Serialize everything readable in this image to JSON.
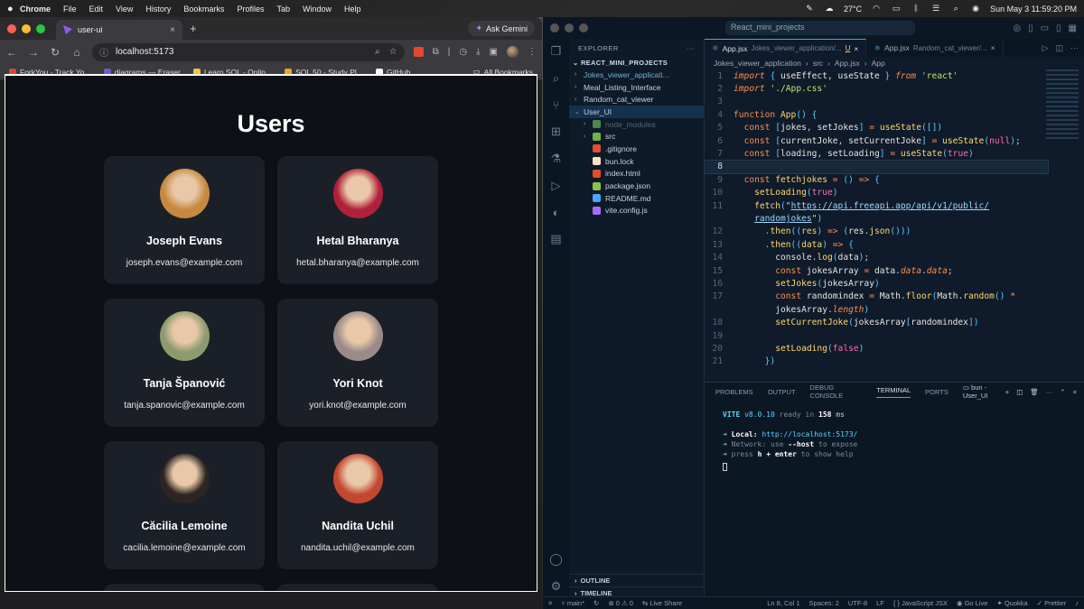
{
  "menubar": {
    "apple": "",
    "items": [
      "Chrome",
      "File",
      "Edit",
      "View",
      "History",
      "Bookmarks",
      "Profiles",
      "Tab",
      "Window",
      "Help"
    ],
    "weather": "27°C",
    "datetime": "Sun May 3  11:59:20 PM"
  },
  "chrome": {
    "tab_title": "user-ui",
    "tab_close": "×",
    "new_tab": "+",
    "ask_gemini": "Ask Gemini",
    "url": "localhost:5173",
    "bookmarks": [
      {
        "label": "ForkYou - Track Yo...",
        "color": "#d9453a"
      },
      {
        "label": "diagrams — Eraser",
        "color": "#6d5bd0"
      },
      {
        "label": "Learn SQL - Onlin...",
        "color": "#f5c242"
      },
      {
        "label": "SQL 50 - Study Pl...",
        "color": "#f0a32b"
      },
      {
        "label": "GitHub",
        "color": "#ffffff"
      }
    ],
    "all_bookmarks": "All Bookmarks"
  },
  "page": {
    "title": "Users",
    "users": [
      {
        "name": "Joseph Evans",
        "email": "joseph.evans@example.com",
        "avatar_color": "#c7893f"
      },
      {
        "name": "Hetal Bharanya",
        "email": "hetal.bharanya@example.com",
        "avatar_color": "#b0203a"
      },
      {
        "name": "Tanja Španović",
        "email": "tanja.spanovic@example.com",
        "avatar_color": "#8c9a6e"
      },
      {
        "name": "Yori Knot",
        "email": "yori.knot@example.com",
        "avatar_color": "#9a8a88"
      },
      {
        "name": "Căcilia Lemoine",
        "email": "cacilia.lemoine@example.com",
        "avatar_color": "#2d2522"
      },
      {
        "name": "Nandita Uchil",
        "email": "nandita.uchil@example.com",
        "avatar_color": "#c4472f"
      }
    ]
  },
  "vscode": {
    "search": "React_mini_projects",
    "explorer_label": "EXPLORER",
    "root": "REACT_MINI_PROJECTS",
    "tree": [
      {
        "label": "Jokes_viewer_applicati...",
        "type": "folder",
        "chev": "›",
        "indent": 0,
        "color": "#6fb3d2"
      },
      {
        "label": "Meal_Listing_Interface",
        "type": "folder",
        "chev": "›",
        "indent": 0,
        "color": "#c7d2dc"
      },
      {
        "label": "Random_cat_viewer",
        "type": "folder",
        "chev": "›",
        "indent": 0,
        "color": "#c7d2dc"
      },
      {
        "label": "User_UI",
        "type": "folder",
        "chev": "⌄",
        "indent": 0,
        "color": "#c7d2dc"
      },
      {
        "label": "node_modules",
        "type": "folder",
        "chev": "›",
        "indent": 1,
        "color": "#566677"
      },
      {
        "label": "src",
        "type": "folder",
        "chev": "›",
        "indent": 1,
        "color": "#c7d2dc"
      },
      {
        "label": ".gitignore",
        "type": "file",
        "chev": "",
        "indent": 1,
        "color": "#c7d2dc"
      },
      {
        "label": "bun.lock",
        "type": "file",
        "chev": "",
        "indent": 1,
        "color": "#c7d2dc"
      },
      {
        "label": "index.html",
        "type": "file",
        "chev": "",
        "indent": 1,
        "color": "#c7d2dc"
      },
      {
        "label": "package.json",
        "type": "file",
        "chev": "",
        "indent": 1,
        "color": "#c7d2dc"
      },
      {
        "label": "README.md",
        "type": "file",
        "chev": "",
        "indent": 1,
        "color": "#c7d2dc"
      },
      {
        "label": "vite.config.js",
        "type": "file",
        "chev": "",
        "indent": 1,
        "color": "#c7d2dc"
      }
    ],
    "outline": "OUTLINE",
    "timeline": "TIMELINE",
    "tabs": [
      {
        "file": "App.jsx",
        "path": "Jokes_viewer_application/...",
        "flag": "U",
        "active": true
      },
      {
        "file": "App.jsx",
        "path": "Random_cat_viewer/...",
        "flag": "",
        "active": false
      }
    ],
    "breadcrumbs": [
      "Jokes_viewer_application",
      "src",
      "App.jsx",
      "App"
    ],
    "code_lines": [
      {
        "no": "1",
        "html": "<span class=\"kw\">import</span> <span class=\"p\">{</span> <span class=\"v\">useEffect</span>, <span class=\"v\">useState</span> <span class=\"p\">}</span> <span class=\"kw\">from</span> <span class=\"s\">'react'</span>"
      },
      {
        "no": "2",
        "html": "<span class=\"kw\">import</span> <span class=\"s\">'./App.css'</span>"
      },
      {
        "no": "3",
        "html": ""
      },
      {
        "no": "4",
        "html": "<span class=\"k\">function</span> <span class=\"f\">App</span><span class=\"p\">()</span> <span class=\"p\">{</span>"
      },
      {
        "no": "5",
        "html": "  <span class=\"k\">const</span> <span class=\"p\">[</span><span class=\"v\">jokes</span>, <span class=\"v\">setJokes</span><span class=\"p\">]</span> <span class=\"k\">=</span> <span class=\"f\">useState</span><span class=\"p\">([])</span>"
      },
      {
        "no": "6",
        "html": "  <span class=\"k\">const</span> <span class=\"p\">[</span><span class=\"v\">currentJoke</span>, <span class=\"v\">setCurrentJoke</span><span class=\"p\">]</span> <span class=\"k\">=</span> <span class=\"f\">useState</span><span class=\"p\">(</span><span class=\"n\">null</span><span class=\"p\">)</span>;"
      },
      {
        "no": "7",
        "html": "  <span class=\"k\">const</span> <span class=\"p\">[</span><span class=\"v\">loading</span>, <span class=\"v\">setLoading</span><span class=\"p\">]</span> <span class=\"k\">=</span> <span class=\"f\">useState</span><span class=\"p\">(</span><span class=\"n\">true</span><span class=\"p\">)</span>"
      },
      {
        "no": "8",
        "html": "",
        "current": true
      },
      {
        "no": "9",
        "html": "  <span class=\"k\">const</span> <span class=\"f\">fetchjokes</span> <span class=\"k\">=</span> <span class=\"p\">()</span> <span class=\"k\">=&gt;</span> <span class=\"p\">{</span>"
      },
      {
        "no": "10",
        "html": "    <span class=\"f\">setLoading</span><span class=\"p\">(</span><span class=\"n\">true</span><span class=\"p\">)</span>"
      },
      {
        "no": "11",
        "html": "    <span class=\"f\">fetch</span><span class=\"p\">(</span><span class=\"s\">\"</span><span class=\"u\">https://api.freeapi.app/api/v1/public/</span>"
      },
      {
        "no": "",
        "html": "    <span class=\"u\">randomjokes</span><span class=\"s\">\"</span><span class=\"p\">)</span>"
      },
      {
        "no": "12",
        "html": "      <span class=\"p\">.</span><span class=\"f\">then</span><span class=\"p\">((</span><span class=\"pm\">res</span><span class=\"p\">)</span> <span class=\"k\">=&gt;</span> <span class=\"p\">(</span><span class=\"v\">res</span>.<span class=\"f\">json</span><span class=\"p\">()))</span>"
      },
      {
        "no": "13",
        "html": "      <span class=\"p\">.</span><span class=\"f\">then</span><span class=\"p\">((</span><span class=\"pm\">data</span><span class=\"p\">)</span> <span class=\"k\">=&gt;</span> <span class=\"p\">{</span>"
      },
      {
        "no": "14",
        "html": "        <span class=\"v\">console</span>.<span class=\"f\">log</span><span class=\"p\">(</span><span class=\"v\">data</span><span class=\"p\">)</span>;"
      },
      {
        "no": "15",
        "html": "        <span class=\"k\">const</span> <span class=\"v\">jokesArray</span> <span class=\"k\">=</span> <span class=\"v\">data</span>.<span class=\"kw\">data</span>.<span class=\"kw\">data</span>;"
      },
      {
        "no": "16",
        "html": "        <span class=\"f\">setJokes</span><span class=\"p\">(</span><span class=\"v\">jokesArray</span><span class=\"p\">)</span>"
      },
      {
        "no": "17",
        "html": "        <span class=\"k\">const</span> <span class=\"v\">randomindex</span> <span class=\"k\">=</span> <span class=\"v\">Math</span>.<span class=\"f\">floor</span><span class=\"p\">(</span><span class=\"v\">Math</span>.<span class=\"f\">random</span><span class=\"p\">()</span> <span class=\"k\">*</span>"
      },
      {
        "no": "",
        "html": "        <span class=\"v\">jokesArray</span>.<span class=\"kw\">length</span><span class=\"p\">)</span>"
      },
      {
        "no": "18",
        "html": "        <span class=\"f\">setCurrentJoke</span><span class=\"p\">(</span><span class=\"v\">jokesArray</span><span class=\"p\">[</span><span class=\"v\">randomindex</span><span class=\"p\">])</span>"
      },
      {
        "no": "19",
        "html": ""
      },
      {
        "no": "20",
        "html": "        <span class=\"f\">setLoading</span><span class=\"p\">(</span><span class=\"n\">false</span><span class=\"p\">)</span>"
      },
      {
        "no": "21",
        "html": "      <span class=\"p\">})</span>"
      }
    ],
    "panel_tabs": [
      "PROBLEMS",
      "OUTPUT",
      "DEBUG CONSOLE",
      "TERMINAL",
      "PORTS"
    ],
    "active_panel": "TERMINAL",
    "terminal_name": "bun - User_UI",
    "terminal": {
      "vite": "VITE",
      "version": "v8.0.10",
      "ready": "ready in",
      "ms": "158",
      "ms_unit": "ms",
      "local_label": "Local:",
      "local_url": "http://localhost:5173/",
      "network": "Network: use",
      "network_flag": "--host",
      "network_rest": "to expose",
      "help_press": "press",
      "help_key": "h + enter",
      "help_rest": "to show help"
    },
    "status": {
      "branch": "main*",
      "errors": "0",
      "warnings": "0",
      "live_share": "Live Share",
      "position": "Ln 8, Col 1",
      "spaces": "Spaces: 2",
      "encoding": "UTF-8",
      "eol": "LF",
      "language": "JavaScript JSX",
      "go_live": "Go Live",
      "quokka": "Quokka",
      "prettier": "Prettier"
    }
  }
}
